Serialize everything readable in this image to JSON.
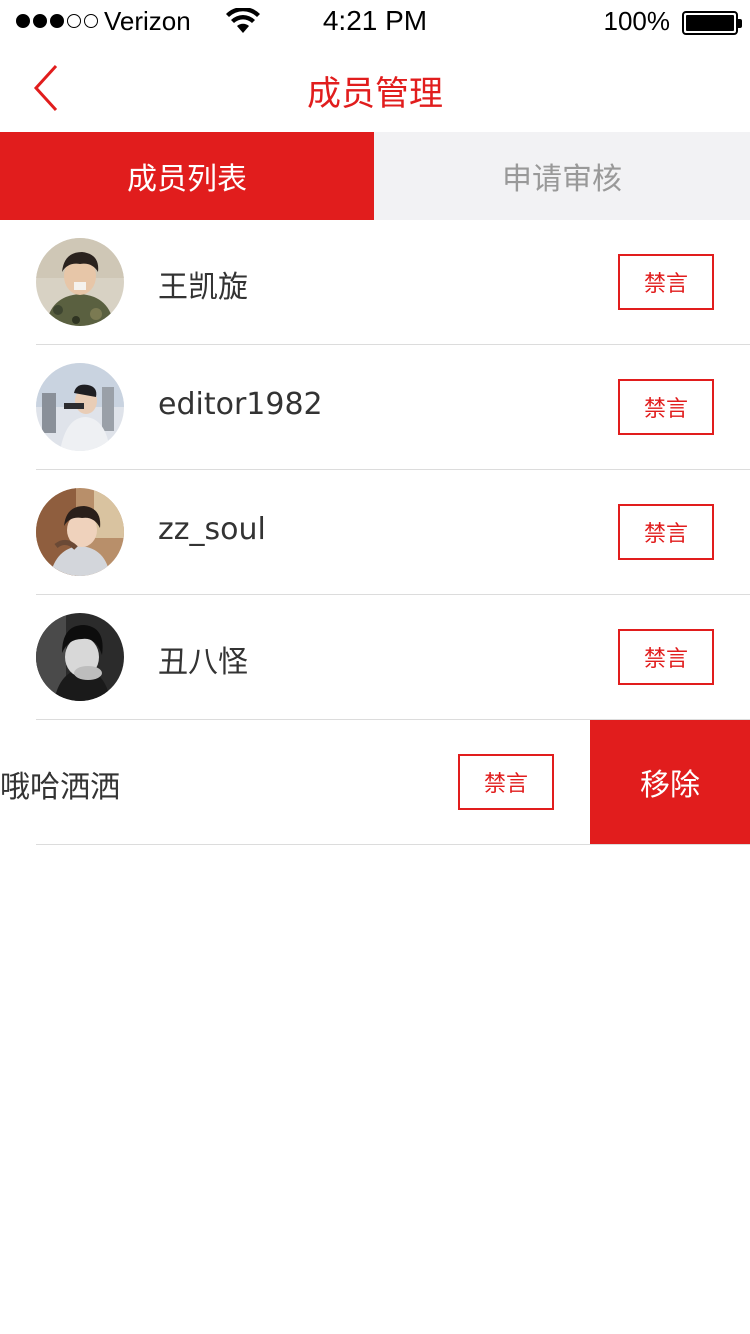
{
  "status_bar": {
    "carrier": "Verizon",
    "time": "4:21 PM",
    "battery": "100%",
    "signal_bars_filled": 3,
    "signal_bars_total": 5
  },
  "nav": {
    "title": "成员管理",
    "back_icon": "chevron-left-icon"
  },
  "tabs": [
    {
      "label": "成员列表",
      "active": true
    },
    {
      "label": "申请审核",
      "active": false
    }
  ],
  "members": [
    {
      "name": "王凯旋",
      "mute_label": "禁言"
    },
    {
      "name": "editor1982",
      "mute_label": "禁言"
    },
    {
      "name": "zz_soul",
      "mute_label": "禁言"
    },
    {
      "name": "丑八怪",
      "mute_label": "禁言"
    },
    {
      "name": "哦哈洒洒",
      "mute_label": "禁言",
      "remove_label": "移除"
    }
  ],
  "colors": {
    "accent": "#e11d1d",
    "tab_inactive_bg": "#f2f2f4",
    "tab_inactive_text": "#999999",
    "divider": "#dcdcdc"
  }
}
